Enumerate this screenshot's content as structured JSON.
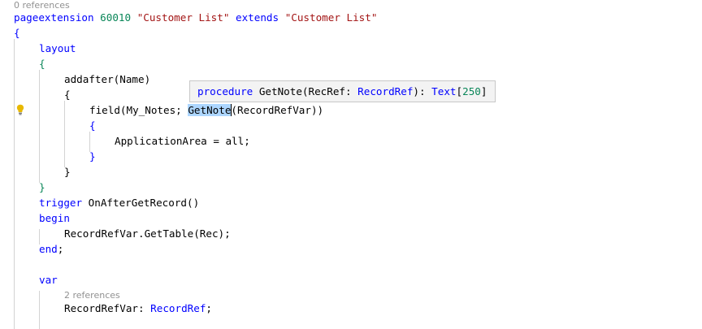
{
  "editor": {
    "codelens": {
      "top": "0 references",
      "var_refs": "2 references"
    },
    "lines": {
      "l1": {
        "kw1": "pageextension",
        "num": "60010",
        "str1": "\"Customer List\"",
        "kw2": "extends",
        "str2": "\"Customer List\""
      },
      "l2": {
        "brace": "{"
      },
      "l3": {
        "kw": "layout"
      },
      "l4": {
        "brace": "{"
      },
      "l5": {
        "fn": "addafter",
        "arg": "(Name)"
      },
      "l6": {
        "brace": "{"
      },
      "l7": {
        "fn": "field",
        "args_pre": "(My_Notes; ",
        "sel": "GetNote",
        "args_post": "(RecordRefVar))"
      },
      "l8": {
        "brace": "{"
      },
      "l9": {
        "text": "ApplicationArea = all;"
      },
      "l10": {
        "brace": "}"
      },
      "l11": {
        "brace": "}"
      },
      "l12": {
        "brace": "}"
      },
      "l13": {
        "kw": "trigger",
        "text": "OnAfterGetRecord()"
      },
      "l14": {
        "kw": "begin"
      },
      "l15": {
        "text": "RecordRefVar.GetTable(Rec);"
      },
      "l16": {
        "kw": "end",
        "punct": ";"
      },
      "l17": {
        "kw": "var"
      },
      "l18": {
        "name": "RecordRefVar: ",
        "type": "RecordRef",
        "punct": ";"
      }
    },
    "hover": {
      "kw": "procedure",
      "name": "GetNote(RecRef: ",
      "type1": "RecordRef",
      "mid": "): ",
      "type2": "Text",
      "bracket_open": "[",
      "num": "250",
      "bracket_close": "]"
    },
    "lightbulb_icon": "lightbulb-icon",
    "colors": {
      "keyword": "#0000ff",
      "string": "#a31515",
      "number": "#098658",
      "type": "#267f99",
      "selection": "#add6ff",
      "codelens": "#919191",
      "lightbulb": "#e8b800"
    }
  }
}
